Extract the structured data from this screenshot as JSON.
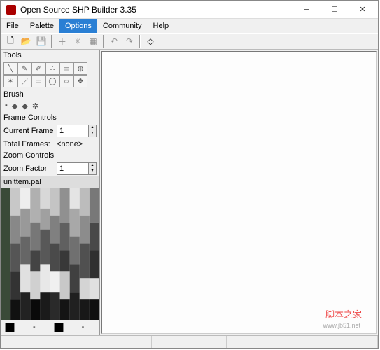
{
  "window": {
    "title": "Open Source SHP Builder 3.35"
  },
  "menu": {
    "file": "File",
    "palette": "Palette",
    "options": "Options",
    "community": "Community",
    "help": "Help"
  },
  "sidebar": {
    "tools_label": "Tools",
    "brush_label": "Brush",
    "frame_controls_label": "Frame Controls",
    "current_frame_label": "Current Frame",
    "current_frame_value": "1",
    "total_frames_label": "Total Frames:",
    "total_frames_value": "<none>",
    "zoom_controls_label": "Zoom Controls",
    "zoom_factor_label": "Zoom Factor",
    "zoom_factor_value": "1",
    "palette_filename": "unittem.pal"
  },
  "colors": {
    "fg": "#000000",
    "bg": "#000000"
  },
  "watermark": {
    "text": "脚本之家",
    "url": "www.jb51.net"
  }
}
